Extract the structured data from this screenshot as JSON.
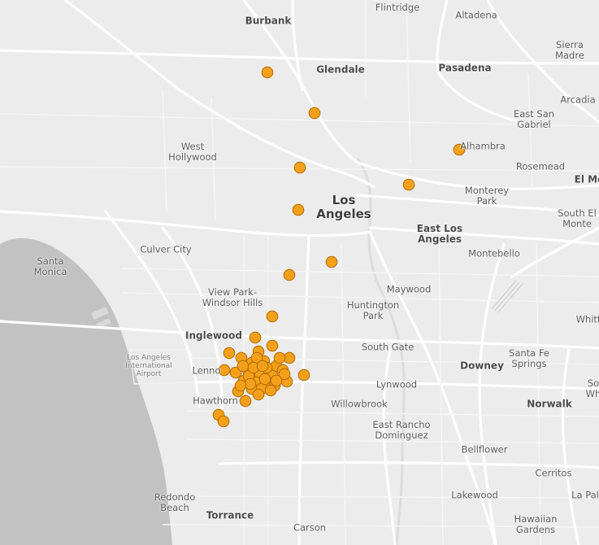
{
  "map": {
    "labels": [
      {
        "id": "la-canada-flintridge",
        "text": "La Cañada\nFlintridge",
        "tier": "minor"
      },
      {
        "id": "altadena",
        "text": "Altadena",
        "tier": "minor"
      },
      {
        "id": "burbank",
        "text": "Burbank",
        "tier": "major"
      },
      {
        "id": "glendale",
        "text": "Glendale",
        "tier": "major"
      },
      {
        "id": "pasadena",
        "text": "Pasadena",
        "tier": "major"
      },
      {
        "id": "sierra-madre",
        "text": "Sierra\nMadre",
        "tier": "minor"
      },
      {
        "id": "arcadia",
        "text": "Arcadia",
        "tier": "minor"
      },
      {
        "id": "east-san-gabriel",
        "text": "East San\nGabriel",
        "tier": "minor"
      },
      {
        "id": "alhambra",
        "text": "Alhambra",
        "tier": "minor"
      },
      {
        "id": "rosemead",
        "text": "Rosemead",
        "tier": "minor"
      },
      {
        "id": "el-monte",
        "text": "El Mo",
        "tier": "major"
      },
      {
        "id": "west-hollywood",
        "text": "West\nHollywood",
        "tier": "minor"
      },
      {
        "id": "los-angeles",
        "text": "Los\nAngeles",
        "tier": "big"
      },
      {
        "id": "monterey-park",
        "text": "Monterey\nPark",
        "tier": "minor"
      },
      {
        "id": "south-el-monte",
        "text": "South El\nMonte",
        "tier": "minor"
      },
      {
        "id": "east-los-angeles",
        "text": "East Los\nAngeles",
        "tier": "major"
      },
      {
        "id": "culver-city",
        "text": "Culver City",
        "tier": "minor"
      },
      {
        "id": "montebello",
        "text": "Montebello",
        "tier": "minor"
      },
      {
        "id": "santa-monica",
        "text": "Santa\nMonica",
        "tier": "minor"
      },
      {
        "id": "maywood",
        "text": "Maywood",
        "tier": "minor"
      },
      {
        "id": "view-park-windsor-hills",
        "text": "View Park-\nWindsor Hills",
        "tier": "minor"
      },
      {
        "id": "huntington-park",
        "text": "Huntington\nPark",
        "tier": "minor"
      },
      {
        "id": "whittier",
        "text": "Whitt",
        "tier": "minor"
      },
      {
        "id": "inglewood",
        "text": "Inglewood",
        "tier": "major"
      },
      {
        "id": "south-gate",
        "text": "South Gate",
        "tier": "minor"
      },
      {
        "id": "lax",
        "text": "Los Angeles\nInternational\nAirport",
        "tier": "tiny"
      },
      {
        "id": "lennox",
        "text": "Lenno",
        "tier": "minor"
      },
      {
        "id": "santa-fe-springs",
        "text": "Santa Fe\nSprings",
        "tier": "minor"
      },
      {
        "id": "downey",
        "text": "Downey",
        "tier": "major"
      },
      {
        "id": "lynwood",
        "text": "Lynwood",
        "tier": "minor"
      },
      {
        "id": "hawthorne",
        "text": "Hawthorn",
        "tier": "minor"
      },
      {
        "id": "willowbrook",
        "text": "Willowbrook",
        "tier": "minor"
      },
      {
        "id": "norwalk",
        "text": "Norwalk",
        "tier": "major"
      },
      {
        "id": "south-whittier",
        "text": "So\nWh",
        "tier": "minor"
      },
      {
        "id": "east-rancho-dominguez",
        "text": "East Rancho\nDominguez",
        "tier": "minor"
      },
      {
        "id": "bellflower",
        "text": "Bellflower",
        "tier": "minor"
      },
      {
        "id": "cerritos",
        "text": "Cerritos",
        "tier": "minor"
      },
      {
        "id": "redondo-beach",
        "text": "Redondo\nBeach",
        "tier": "minor"
      },
      {
        "id": "lakewood",
        "text": "Lakewood",
        "tier": "minor"
      },
      {
        "id": "la-palma",
        "text": "La Pal",
        "tier": "minor"
      },
      {
        "id": "torrance",
        "text": "Torrance",
        "tier": "major"
      },
      {
        "id": "carson",
        "text": "Carson",
        "tier": "minor"
      },
      {
        "id": "hawaiian-gardens",
        "text": "Hawaiian\nGardens",
        "tier": "minor"
      }
    ],
    "colors": {
      "land": "#ececec",
      "water": "#c2c2c2",
      "road": "#ffffff",
      "marker_fill": "#f5a01a",
      "marker_stroke": "#b06a00"
    }
  }
}
